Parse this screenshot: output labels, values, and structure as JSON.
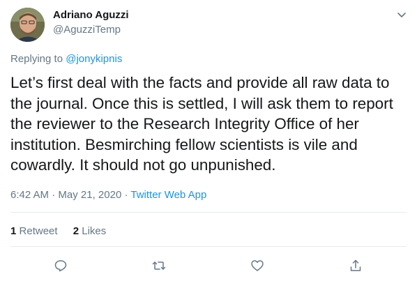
{
  "author": {
    "name": "Adriano Aguzzi",
    "handle": "@AguzziTemp"
  },
  "reply": {
    "prefix": "Replying to ",
    "to": "@jonykipnis"
  },
  "tweet": {
    "lines": [
      "Let’s first deal with the facts and provide all raw data to",
      "the journal. Once this is settled, I will ask them to report",
      "the reviewer to the Research Integrity Office of her",
      "institution. Besmirching fellow scientists is vile and",
      "cowardly. It should not go unpunished."
    ]
  },
  "meta": {
    "time": "6:42 AM",
    "sep1": " · ",
    "date": "May 21, 2020",
    "sep2": " · ",
    "source": "Twitter Web App"
  },
  "stats": {
    "retweets_count": "1",
    "retweets_label": "Retweet",
    "likes_count": "2",
    "likes_label": "Likes"
  },
  "actions": [
    "reply-icon",
    "retweet-icon",
    "like-icon",
    "share-icon"
  ],
  "colors": {
    "link": "#1b95e0",
    "secondary": "#657786",
    "divider": "#e6ecf0"
  }
}
